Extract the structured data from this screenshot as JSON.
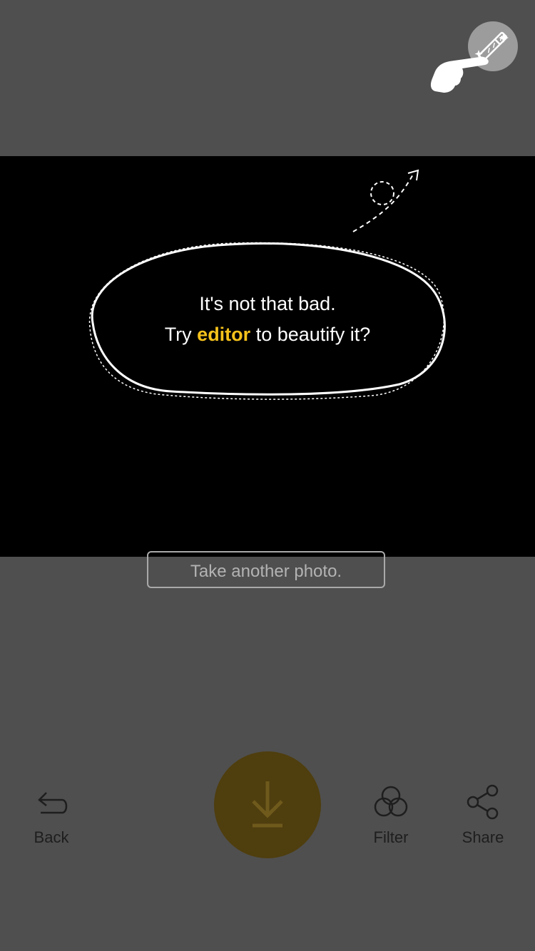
{
  "tooltip": {
    "line1": "It's not that bad.",
    "line2_prefix": "Try ",
    "line2_highlight": "editor",
    "line2_suffix": " to beautify it?",
    "highlight_color": "#f5c21b"
  },
  "retake": {
    "label": "Take another photo."
  },
  "toolbar": {
    "back_label": "Back",
    "filter_label": "Filter",
    "share_label": "Share"
  },
  "icons": {
    "magic": "magic-wand-icon",
    "hand": "pointing-hand-icon",
    "back": "undo-arrow-icon",
    "save": "download-icon",
    "filter": "filter-circles-icon",
    "share": "share-icon"
  },
  "colors": {
    "background": "#4f4f4f",
    "photo": "#000000",
    "accent_dim": "#4f3e0e"
  }
}
